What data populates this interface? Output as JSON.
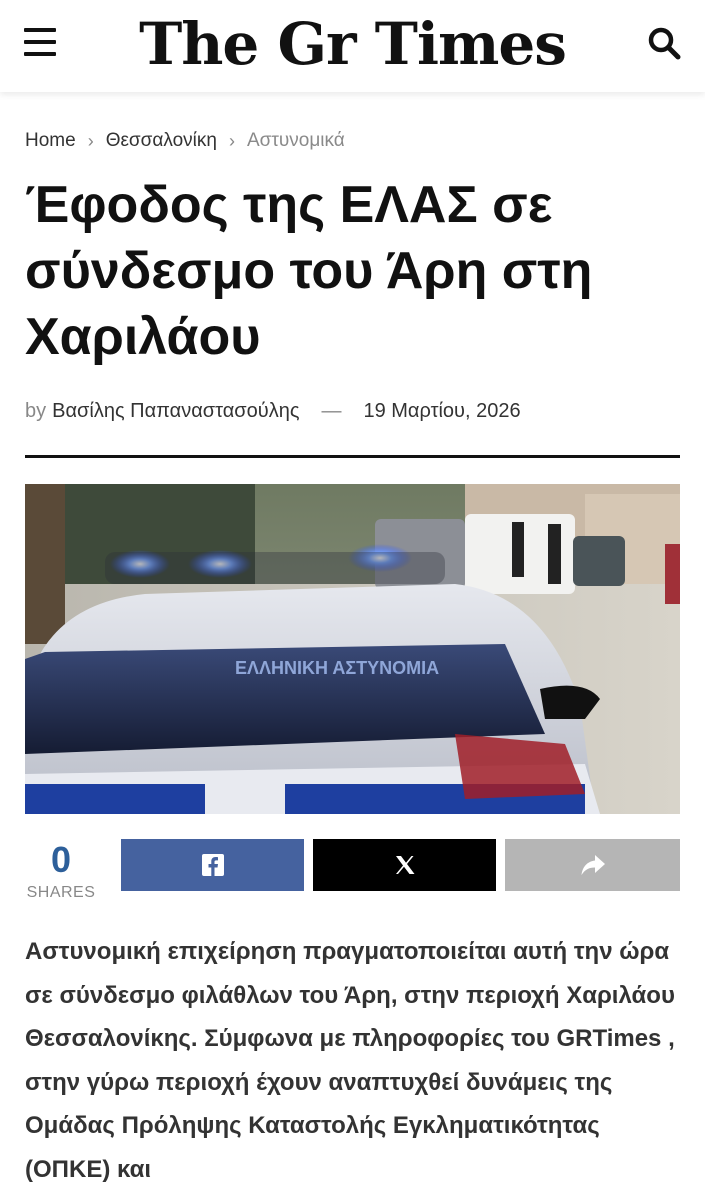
{
  "header": {
    "logo_text": "The Gr Times",
    "menu_icon": "hamburger-menu-icon",
    "search_icon": "search-icon"
  },
  "breadcrumb": {
    "home": "Home",
    "category": "Θεσσαλονίκη",
    "current": "Αστυνομικά",
    "separator_icon": "chevron-right-icon"
  },
  "article": {
    "title": "Έφοδος της ΕΛΑΣ σε σύνδεσμο του Άρη στη Χαριλάου",
    "by_label": "by",
    "author": "Βασίλης Παπαναστασούλης",
    "dash": "—",
    "date": "19 Μαρτίου, 2026",
    "body": "Αστυνομική επιχείρηση πραγματοποιείται αυτή την ώρα σε σύνδεσμο φιλάθλων του Άρη, στην περιοχή Χαριλάου Θεσσαλονίκης. Σύμφωνα με πληροφορίες του GRTimes , στην γύρω περιοχή έχουν αναπτυχθεί δυνάμεις της Ομάδας Πρόληψης Καταστολής Εγκληματικότητας (ΟΠΚΕ) και"
  },
  "hero_image": {
    "car_lettering": "ΕΛΛΗΝΙΚΗ ΑΣΤΥΝΟΜΙΑ"
  },
  "share": {
    "count": "0",
    "label": "SHARES",
    "facebook_icon": "facebook-icon",
    "x_icon": "x-icon",
    "share_icon": "share-arrow-icon"
  },
  "colors": {
    "facebook": "#45629f",
    "x": "#000000",
    "share": "#b5b5b5",
    "share_count": "#2d5f9a"
  }
}
